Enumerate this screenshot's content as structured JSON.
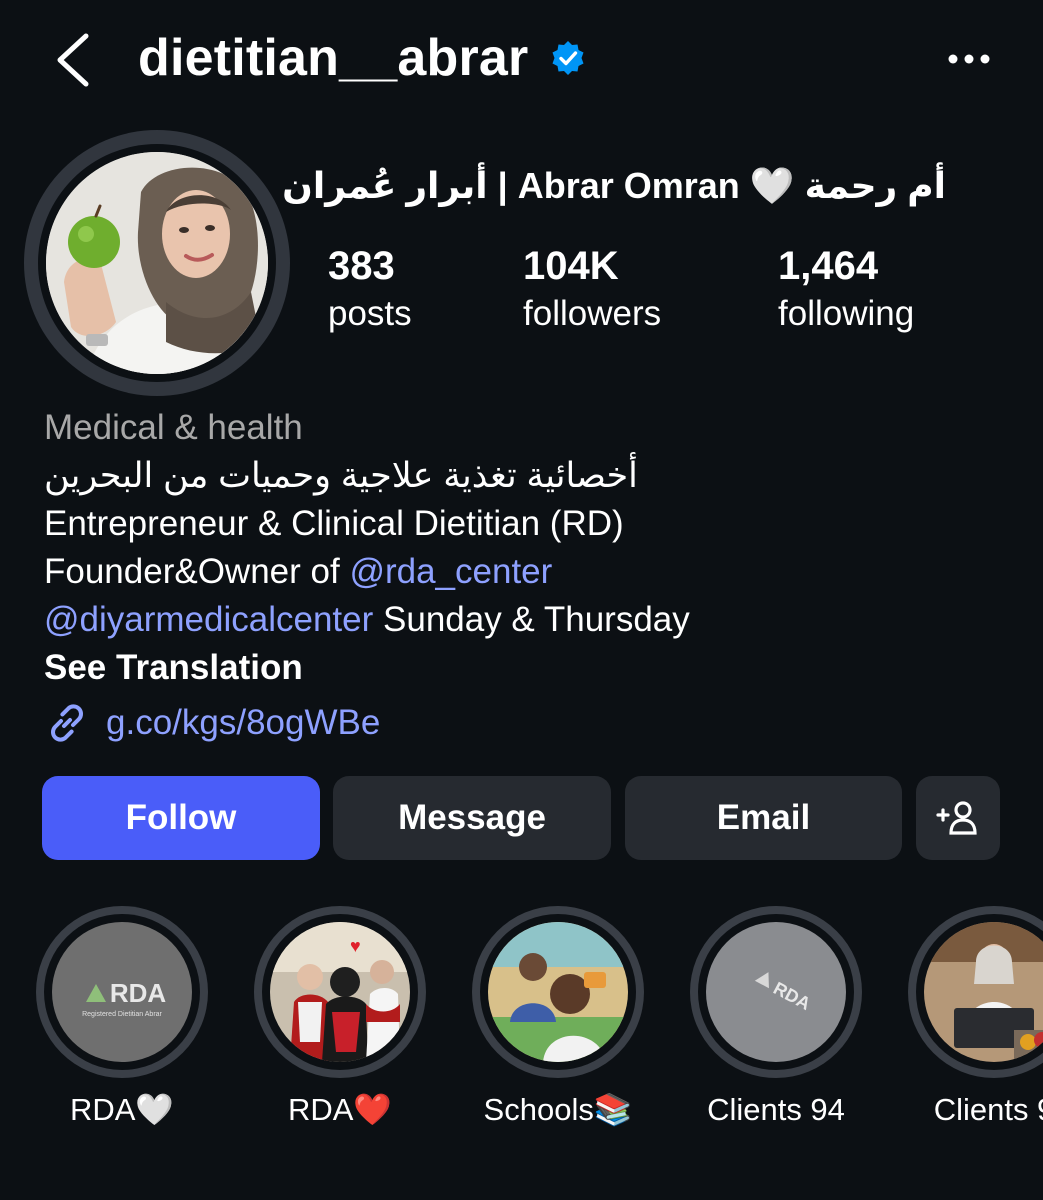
{
  "header": {
    "username": "dietitian__abrar",
    "verified_color": "#0095f6"
  },
  "profile": {
    "full_name": "أم رحمة 🤍 Abrar Omran | أبرار عُمران",
    "stats": {
      "posts_value": "383",
      "posts_label": "posts",
      "followers_value": "104K",
      "followers_label": "followers",
      "following_value": "1,464",
      "following_label": "following"
    }
  },
  "bio": {
    "category": "Medical & health",
    "line_arabic": "أخصائية تغذية علاجية وحميات من البحرين",
    "line_title": "Entrepreneur & Clinical Dietitian (RD)",
    "line_founder_prefix": "Founder&Owner of ",
    "mention_rda": "@rda_center",
    "mention_diyar": "@diyarmedicalcenter",
    "line_schedule": " Sunday & Thursday",
    "see_translation": "See Translation",
    "link": "g.co/kgs/8ogWBe"
  },
  "actions": {
    "follow": "Follow",
    "message": "Message",
    "email": "Email",
    "add_icon": "add-person-icon"
  },
  "highlights": [
    {
      "label": "RDA🤍",
      "logo_text": "RDA",
      "logo_subtext": "Registered Dietitian Abrar"
    },
    {
      "label": "RDA❤️"
    },
    {
      "label": "Schools📚"
    },
    {
      "label": "Clients 94",
      "logo_text": "RDA"
    },
    {
      "label": "Clients 9"
    }
  ],
  "colors": {
    "background": "#0c1014",
    "follow_button": "#4a5df9",
    "secondary_button": "#262a30",
    "link": "#8ea1ff",
    "muted_text": "#a8a8a8"
  }
}
